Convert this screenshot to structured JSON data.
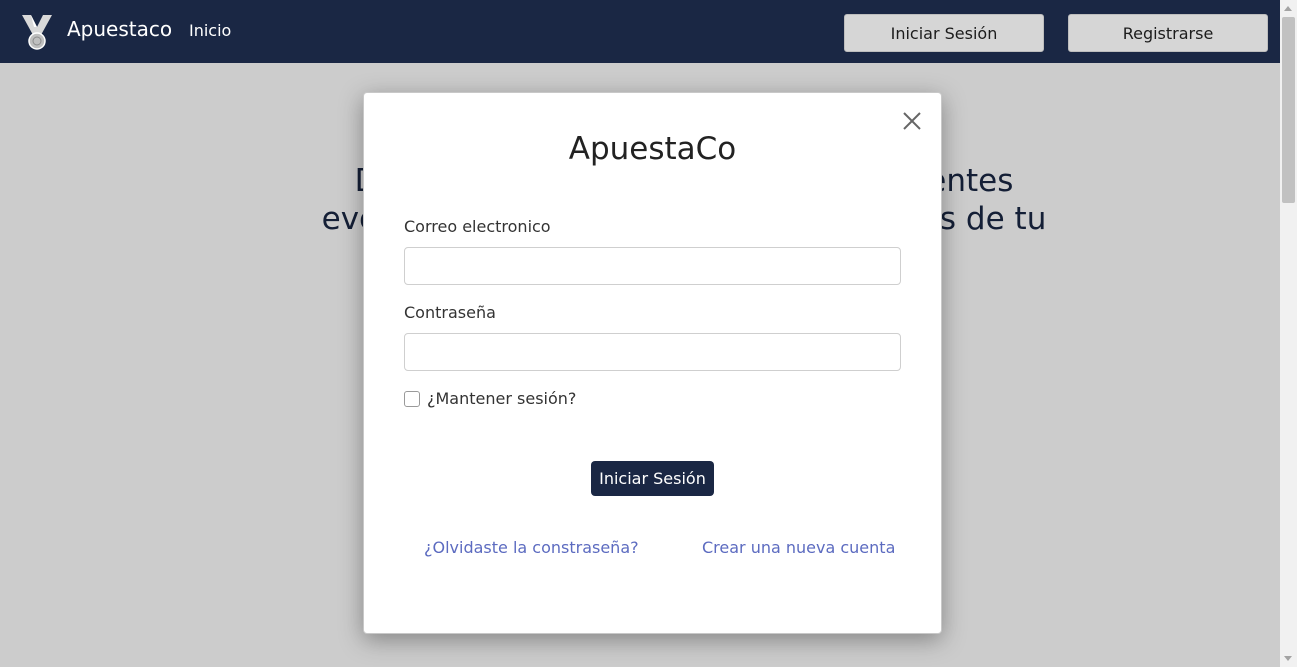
{
  "navbar": {
    "brand": "Apuestaco",
    "links": [
      "Inicio"
    ],
    "login_button": "Iniciar Sesión",
    "register_button": "Registrarse",
    "background": "#1a2744"
  },
  "hero": {
    "line1": "Divié                                             iferentes",
    "line2": "evento                                              abes de tu"
  },
  "modal": {
    "title": "ApuestaCo",
    "email_label": "Correo electronico",
    "email_value": "",
    "password_label": "Contraseña",
    "password_value": "",
    "remember_label": "¿Mantener sesión?",
    "remember_checked": false,
    "submit_label": "Iniciar Sesión",
    "forgot_link": "¿Olvidaste la constraseña?",
    "create_link": "Crear una nueva cuenta",
    "accent": "#1a2744",
    "link_color": "#5c6bc0"
  },
  "icons": {
    "brand": "medal-icon",
    "close": "close-icon"
  }
}
